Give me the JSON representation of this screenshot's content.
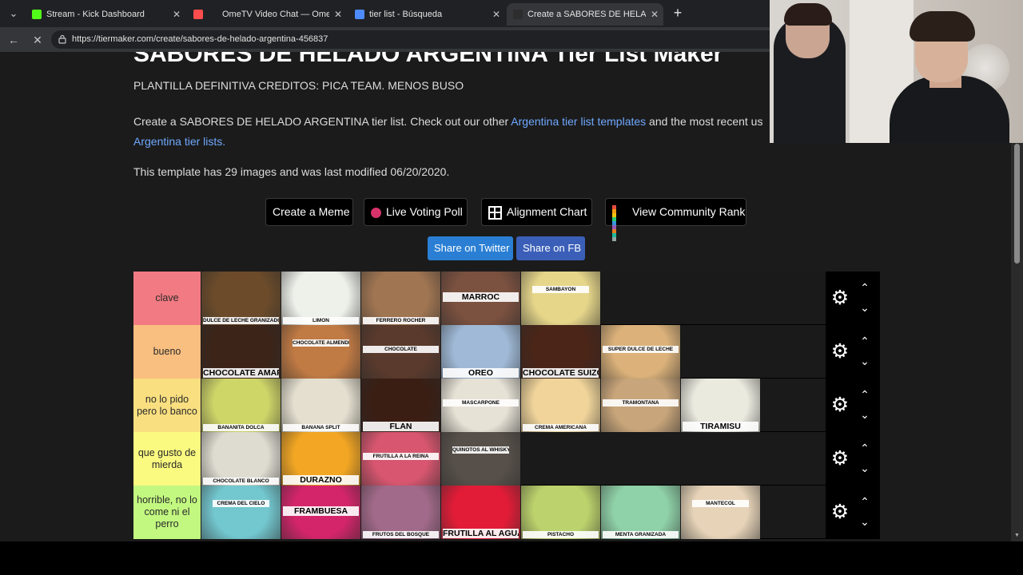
{
  "browser": {
    "tabs": [
      {
        "title": "Stream - Kick Dashboard",
        "favicon_color": "#53fc18"
      },
      {
        "title": "OmeTV Video Chat — Omegle",
        "favicon_color": "#ff4d4d"
      },
      {
        "title": "tier list - Búsqueda",
        "favicon_color": "#4d8bff"
      },
      {
        "title": "Create a SABORES DE HELADO AR",
        "favicon_color": "#2d2d2d"
      }
    ],
    "close_glyph": "✕",
    "new_tab_glyph": "+",
    "url": "https://tiermaker.com/create/sabores-de-helado-argentina-456837"
  },
  "page": {
    "heading": "SABORES DE HELADO ARGENTINA Tier List Maker",
    "description": "PLANTILLA DEFINITIVA CREDITOS: PICA TEAM. MENOS BUSO",
    "intro": {
      "prefix": "Create a SABORES DE HELADO ARGENTINA tier list. Check out our other ",
      "link1": "Argentina tier list templates",
      "middle": " and the most recent us",
      "link2": "Argentina tier lists."
    },
    "info": "This template has 29 images and was last modified 06/20/2020.",
    "buttons": {
      "meme": "Create a Meme",
      "poll": "Live Voting Poll",
      "alignment": "Alignment Chart",
      "community": "View Community Rank",
      "twitter": "Share on Twitter",
      "facebook": "Share on FB"
    }
  },
  "tiers": [
    {
      "label": "clave",
      "color": "#f27a82",
      "items": [
        {
          "caption": "DULCE DE LECHE GRANIZADO",
          "style": "small",
          "bg": "#6b4b2a"
        },
        {
          "caption": "LIMON",
          "style": "small",
          "bg": "#eef0ea"
        },
        {
          "caption": "FERRERO ROCHER",
          "style": "small",
          "bg": "#a07552"
        },
        {
          "caption": "MARROC",
          "style": "bigmid",
          "bg": "#7b5140"
        },
        {
          "caption": "SAMBAYON",
          "style": "topcap",
          "bg": "#e6d68a"
        }
      ]
    },
    {
      "label": "bueno",
      "color": "#f9bf80",
      "items": [
        {
          "caption": "CHOCOLATE AMARGO",
          "style": "big",
          "bg": "#3d2418"
        },
        {
          "caption": "CHOCOLATE ALMENDRADO",
          "style": "topcap",
          "bg": "#c07a44"
        },
        {
          "caption": "CHOCOLATE",
          "style": "mid",
          "bg": "#5a3a2c"
        },
        {
          "caption": "OREO",
          "style": "big",
          "bg": "#9fb9d6"
        },
        {
          "caption": "CHOCOLATE SUIZO",
          "style": "big",
          "bg": "#4a2518"
        },
        {
          "caption": "SUPER DULCE DE LECHE",
          "style": "mid",
          "bg": "#dcb27a"
        }
      ]
    },
    {
      "label": "no lo pido pero lo banco",
      "color": "#f9df80",
      "items": [
        {
          "caption": "BANANITA DOLCA",
          "style": "small",
          "bg": "#cfd668"
        },
        {
          "caption": "BANANA SPLIT",
          "style": "small",
          "bg": "#e4dfcf"
        },
        {
          "caption": "FLAN",
          "style": "big",
          "bg": "#3a1e14"
        },
        {
          "caption": "MASCARPONE",
          "style": "mid",
          "bg": "#e7e2d6"
        },
        {
          "caption": "CREMA AMERICANA",
          "style": "small",
          "bg": "#f0d49a"
        },
        {
          "caption": "TRAMONTANA",
          "style": "mid",
          "bg": "#c8a57a"
        },
        {
          "caption": "TIRAMISU",
          "style": "big",
          "bg": "#eaeadf"
        }
      ]
    },
    {
      "label": "que gusto de mierda",
      "color": "#fafa80",
      "items": [
        {
          "caption": "CHOCOLATE BLANCO",
          "style": "small",
          "bg": "#dedbd0"
        },
        {
          "caption": "DURAZNO",
          "style": "big",
          "bg": "#f2a623"
        },
        {
          "caption": "FRUTILLA A LA REINA",
          "style": "mid",
          "bg": "#d8566f"
        },
        {
          "caption": "QUINOTOS AL WHISKY",
          "style": "topcap",
          "bg": "#57504a"
        }
      ]
    },
    {
      "label": "horrible, no lo come ni el perro",
      "color": "#c2f880",
      "items": [
        {
          "caption": "CREMA DEL CIELO",
          "style": "topcap",
          "bg": "#73c7cf"
        },
        {
          "caption": "FRAMBUESA",
          "style": "bigmid",
          "bg": "#d4256a"
        },
        {
          "caption": "FRUTOS DEL BOSQUE",
          "style": "small",
          "bg": "#a26a8a"
        },
        {
          "caption": "FRUTILLA AL AGUA",
          "style": "big",
          "bg": "#e21c37"
        },
        {
          "caption": "PISTACHO",
          "style": "small",
          "bg": "#bcd26c"
        },
        {
          "caption": "MENTA GRANIZADA",
          "style": "small",
          "bg": "#8fd1a8"
        },
        {
          "caption": "MANTECOL",
          "style": "topcap",
          "bg": "#e6d3b8"
        }
      ]
    }
  ]
}
